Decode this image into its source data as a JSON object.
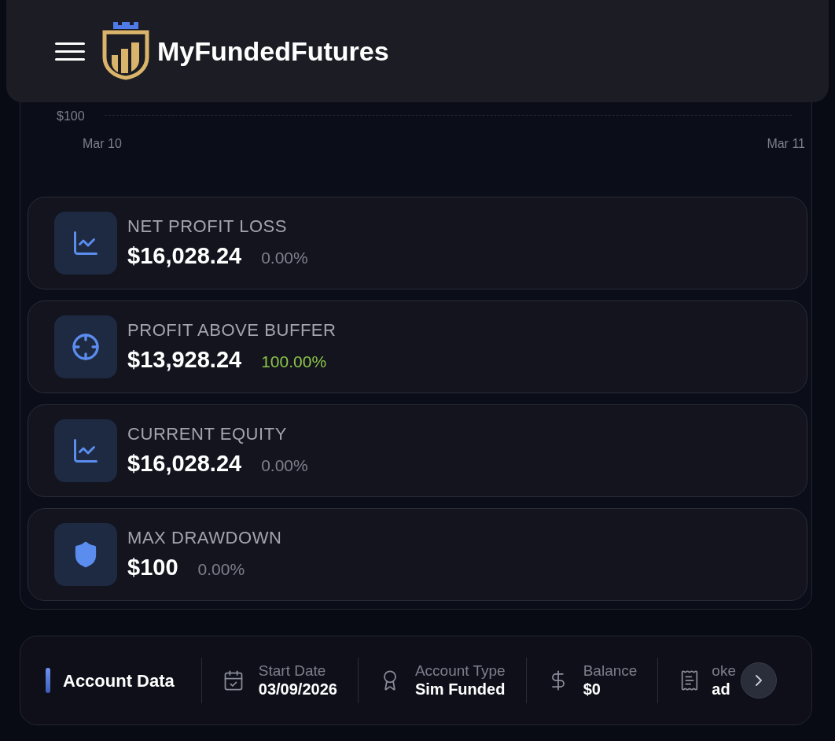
{
  "header": {
    "brand": "MyFundedFutures"
  },
  "chart": {
    "y_tick": "$100",
    "x_ticks": [
      "Mar 10",
      "Mar 11"
    ]
  },
  "stats": [
    {
      "kind": "trend",
      "label": "NET PROFIT LOSS",
      "value": "$16,028.24",
      "percent": "0.00%",
      "positive": false
    },
    {
      "kind": "target",
      "label": "PROFIT ABOVE BUFFER",
      "value": "$13,928.24",
      "percent": "100.00%",
      "positive": true
    },
    {
      "kind": "trend",
      "label": "CURRENT EQUITY",
      "value": "$16,028.24",
      "percent": "0.00%",
      "positive": false
    },
    {
      "kind": "risk",
      "label": "MAX DRAWDOWN",
      "value": "$100",
      "percent": "0.00%",
      "positive": false
    }
  ],
  "account_data": {
    "title": "Account Data",
    "items": [
      {
        "kind": "date",
        "label": "Start Date",
        "value": "03/09/2026"
      },
      {
        "kind": "type",
        "label": "Account Type",
        "value": "Sim Funded"
      },
      {
        "kind": "money",
        "label": "Balance",
        "value": "$0"
      },
      {
        "kind": "other",
        "label": "oke",
        "value": "ad"
      }
    ]
  }
}
